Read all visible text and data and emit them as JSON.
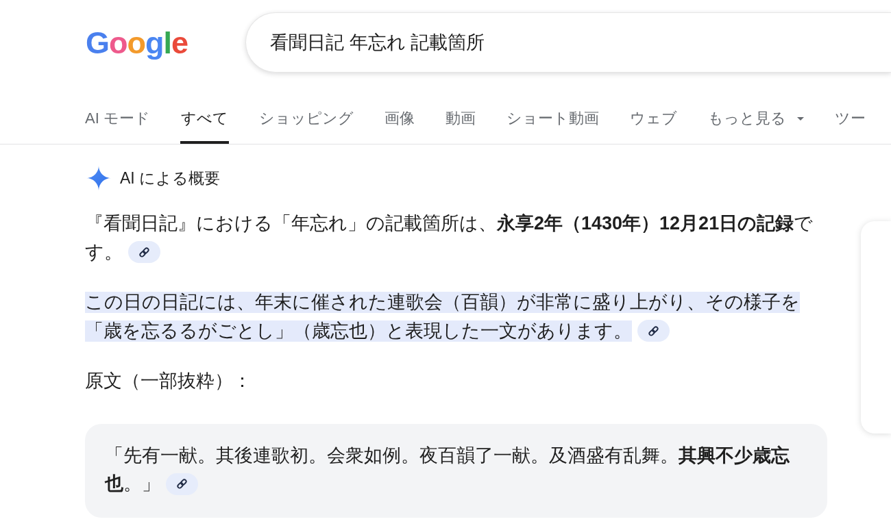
{
  "logo": {
    "text": "Google"
  },
  "search": {
    "value": "看聞日記 年忘れ 記載箇所"
  },
  "tabs": [
    {
      "label": "AI モード",
      "kind": "tab",
      "selected": false
    },
    {
      "label": "すべて",
      "kind": "tab",
      "selected": true
    },
    {
      "label": "ショッピング",
      "kind": "tab",
      "selected": false
    },
    {
      "label": "画像",
      "kind": "tab",
      "selected": false
    },
    {
      "label": "動画",
      "kind": "tab",
      "selected": false
    },
    {
      "label": "ショート動画",
      "kind": "tab",
      "selected": false
    },
    {
      "label": "ウェブ",
      "kind": "tab",
      "selected": false
    },
    {
      "label": "もっと見る",
      "kind": "menu",
      "selected": false
    },
    {
      "label": "ツー",
      "kind": "tab",
      "selected": false
    }
  ],
  "ai_overview": {
    "title": "AI による概要",
    "blocks": [
      {
        "kind": "paragraph",
        "lines": [
          "『看聞日記』における「年忘れ」の記載箇所は、**永享2年（1430年）12月21日の記録**で",
          "す。"
        ],
        "highlighted": false,
        "source_link": true
      },
      {
        "kind": "paragraph",
        "lines": [
          "この日の日記には、年末に催された連歌会（百韻）が非常に盛り上がり、その様子を",
          "「歳を忘るるがごとし」（歳忘也）と表現した一文があります。"
        ],
        "highlighted": true,
        "source_link": true
      },
      {
        "kind": "paragraph",
        "lines": [
          "原文（一部抜粋）："
        ],
        "highlighted": false,
        "source_link": false
      },
      {
        "kind": "quote",
        "lines": [
          "「先有一献。其後連歌初。会衆如例。夜百韻了一献。及酒盛有乱舞。**其興不少歳忘**",
          "**也**。」"
        ],
        "source_link": true
      }
    ]
  }
}
